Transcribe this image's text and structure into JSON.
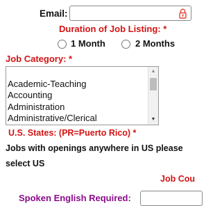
{
  "email": {
    "label": "Email:",
    "value": ""
  },
  "duration": {
    "label": "Duration of Job Listing: *",
    "options": [
      {
        "label": "1 Month",
        "selected": false
      },
      {
        "label": "2 Months",
        "selected": false
      }
    ]
  },
  "job_category": {
    "label": "Job Category: *",
    "items": [
      "Academic-Teaching",
      "Accounting",
      "Administration",
      "Administrative/Clerical"
    ]
  },
  "states": {
    "label": "U.S. States: (PR=Puerto Rico) *",
    "note_line1": "Jobs with openings anywhere in US please",
    "note_line2": "select US"
  },
  "job_country": {
    "label": "Job Cou"
  },
  "spoken_english": {
    "label": "Spoken English Required:"
  },
  "colors": {
    "required_label": "#d31313",
    "english_label": "#8a0c8a",
    "lock_icon": "#e0443a"
  }
}
